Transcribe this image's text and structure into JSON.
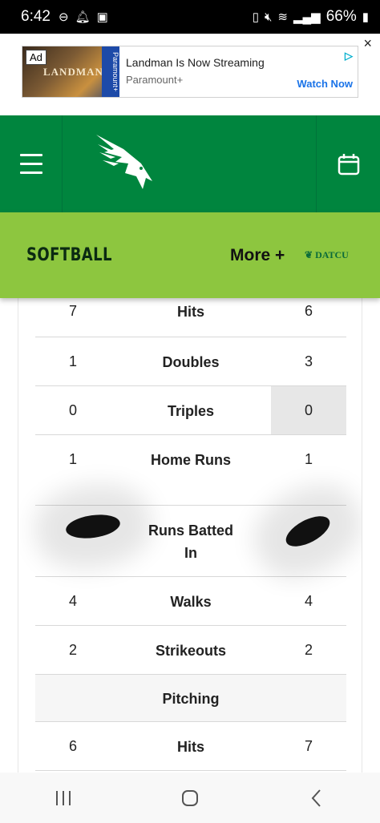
{
  "status_bar": {
    "time": "6:42",
    "battery": "66%",
    "icons": [
      "do-not-disturb-icon",
      "notification-bell-icon",
      "gallery-icon",
      "battery-saver-icon",
      "mute-icon",
      "wifi-icon",
      "signal-icon",
      "battery-icon"
    ]
  },
  "ad": {
    "badge": "Ad",
    "image_title": "LANDMAN",
    "image_stripe": "Paramount+",
    "title": "Landman Is Now Streaming",
    "brand": "Paramount+",
    "cta": "Watch Now",
    "close": "×"
  },
  "header": {
    "logo": "eagle-logo-icon",
    "menu_icon": "hamburger-menu-icon",
    "calendar_icon": "calendar-icon",
    "colors": {
      "primary": "#00853e",
      "accent": "#8dc63f"
    }
  },
  "sport_bar": {
    "title": "SOFTBALL",
    "more": "More +",
    "sponsor": "DATCU"
  },
  "stats": {
    "rows": [
      {
        "left": "7",
        "label": "Hits",
        "right": "6"
      },
      {
        "left": "1",
        "label": "Doubles",
        "right": "3"
      },
      {
        "left": "0",
        "label": "Triples",
        "right": "0"
      },
      {
        "left": "1",
        "label": "Home Runs",
        "right": "1"
      },
      {
        "left": "",
        "label": "Runs Batted In",
        "right": ""
      },
      {
        "left": "4",
        "label": "Walks",
        "right": "4"
      },
      {
        "left": "2",
        "label": "Strikeouts",
        "right": "2"
      },
      {
        "section": "Pitching"
      },
      {
        "left": "6",
        "label": "Hits",
        "right": "7"
      }
    ]
  },
  "navbar": {
    "recents": "recent-apps-icon",
    "home": "home-icon",
    "back": "back-icon"
  }
}
